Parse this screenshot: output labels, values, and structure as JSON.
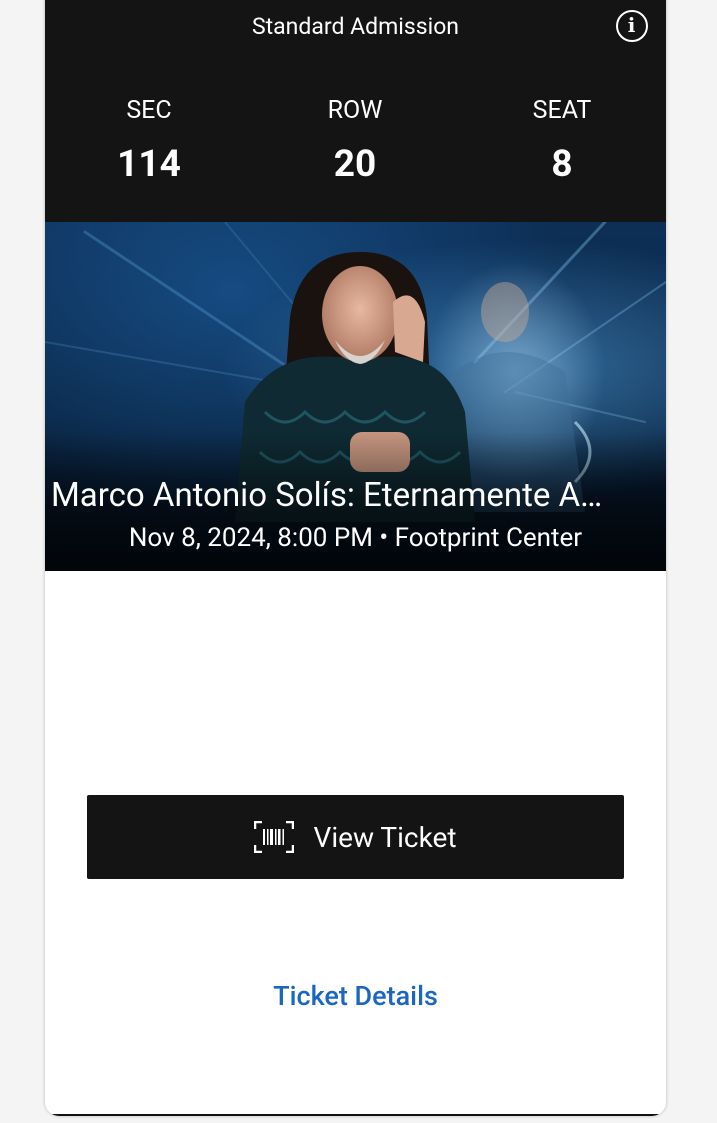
{
  "ticket": {
    "admission_type": "Standard Admission",
    "info_icon": "info-icon",
    "seat": [
      {
        "label": "SEC",
        "value": "114"
      },
      {
        "label": "ROW",
        "value": "20"
      },
      {
        "label": "SEAT",
        "value": "8"
      }
    ]
  },
  "event": {
    "title": "Marco Antonio Solís: Eternamente A…",
    "subtitle": "Nov 8, 2024, 8:00 PM • Footprint Center"
  },
  "actions": {
    "view_ticket_label": "View Ticket",
    "view_ticket_icon": "barcode-scan-icon",
    "ticket_details_label": "Ticket Details"
  },
  "colors": {
    "header_bg": "#141414",
    "button_bg": "#141414",
    "link": "#1a66c0",
    "background": "#f4f4f4"
  }
}
